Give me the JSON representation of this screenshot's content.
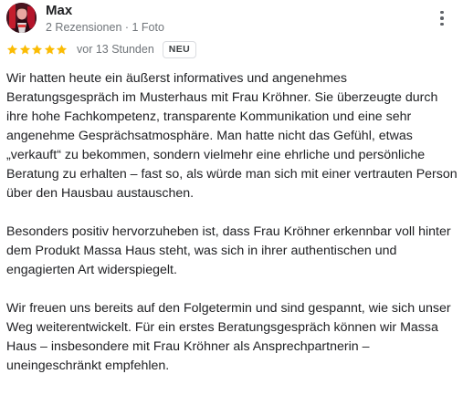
{
  "review": {
    "author": {
      "name": "Max",
      "meta": "2 Rezensionen · 1 Foto",
      "avatar_icon": "profile-photo-icon"
    },
    "more_icon": "more-vert-icon",
    "rating": {
      "stars": 5,
      "max_stars": 5,
      "star_color": "#fbbc04"
    },
    "time_ago": "vor 13 Stunden",
    "badge": "NEU",
    "paragraphs": [
      {
        "lines": [
          "Wir hatten heute ein äußerst informatives und angenehmes",
          "Beratungsgespräch im Musterhaus mit Frau Kröhner. Sie überzeugte durch",
          "ihre hohe Fachkompetenz, transparente Kommunikation und eine sehr",
          "angenehme Gesprächsatmosphäre. Man hatte nicht das Gefühl, etwas",
          "„verkauft“ zu bekommen, sondern vielmehr eine ehrliche und persönliche",
          "Beratung zu erhalten – fast so, als würde man sich mit einer vertrauten Person",
          "über den Hausbau austauschen."
        ]
      },
      {
        "lines": [
          "Besonders positiv hervorzuheben ist, dass Frau Kröhner erkennbar voll hinter",
          "dem Produkt Massa Haus steht, was sich in ihrer authentischen und",
          "engagierten Art widerspiegelt."
        ]
      },
      {
        "lines": [
          "Wir freuen uns bereits auf den Folgetermin und sind gespannt, wie sich unser",
          "Weg weiterentwickelt. Für ein erstes Beratungsgespräch können wir Massa",
          "Haus – insbesondere mit Frau Kröhner als Ansprechpartnerin –",
          "uneingeschränkt empfehlen."
        ]
      }
    ]
  }
}
